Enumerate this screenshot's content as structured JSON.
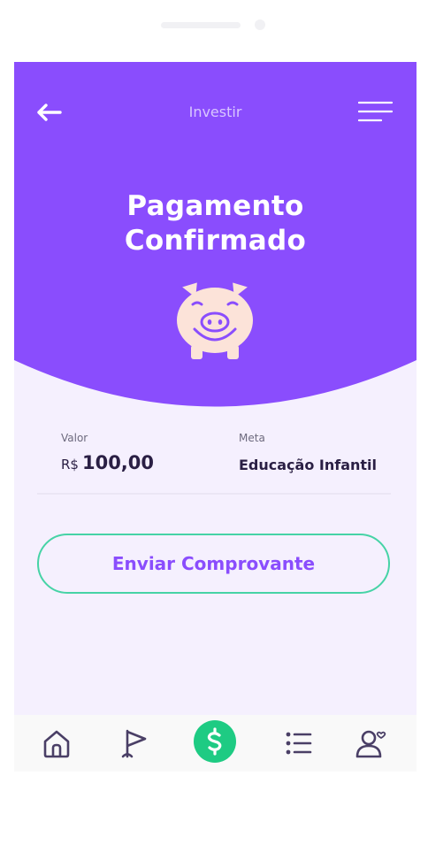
{
  "header": {
    "title": "Investir",
    "back_icon": "arrow-left-icon",
    "menu_icon": "menu-icon"
  },
  "headline": {
    "line1": "Pagamento",
    "line2": "Confirmado"
  },
  "illustration": "piggy-bank-icon",
  "summary": {
    "valor_label": "Valor",
    "valor_currency": "R$",
    "valor_amount": "100,00",
    "meta_label": "Meta",
    "meta_value": "Educação Infantil"
  },
  "action": {
    "send_receipt_label": "Enviar Comprovante"
  },
  "bottom_nav": {
    "items": [
      "home-icon",
      "flag-icon",
      "dollar-icon",
      "list-icon",
      "profile-heart-icon"
    ],
    "active": "dollar-icon"
  },
  "colors": {
    "primary": "#8a4dfd",
    "accent": "#1ecb83",
    "outline": "#46d3a6",
    "background": "#f5f0fe",
    "text_dark": "#2a1f44"
  }
}
